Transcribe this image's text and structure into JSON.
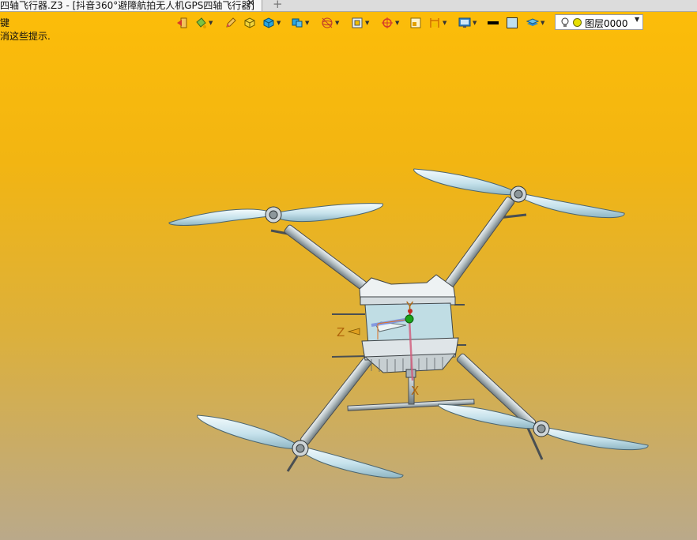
{
  "tab": {
    "title": "四轴飞行器.Z3 - [抖音360°避障航拍无人机GPS四轴飞行器]",
    "close": "✕",
    "add": "+"
  },
  "hints": [
    "键",
    "消这些提示."
  ],
  "toolbar": {
    "tools": [
      {
        "icon": "exit-icon",
        "dropdown": false
      },
      {
        "icon": "paint-bucket-icon",
        "dropdown": true
      },
      {
        "icon": "pencil-icon",
        "dropdown": false
      },
      {
        "icon": "solid-box-icon",
        "dropdown": false
      },
      {
        "icon": "shaded-cube-icon",
        "dropdown": true
      },
      {
        "icon": "stacked-cubes-icon",
        "dropdown": true
      },
      {
        "icon": "wireframe-sphere-icon",
        "dropdown": true
      },
      {
        "icon": "view-frame-icon",
        "dropdown": true
      },
      {
        "icon": "target-snap-icon",
        "dropdown": true
      },
      {
        "icon": "rectangle-select-icon",
        "dropdown": false
      },
      {
        "icon": "dimension-icon",
        "dropdown": true
      },
      {
        "icon": "display-settings-icon",
        "dropdown": true
      },
      {
        "icon": "line-thickness-icon",
        "dropdown": false
      },
      {
        "icon": "color-swatch-icon",
        "dropdown": false
      },
      {
        "icon": "layer-stack-icon",
        "dropdown": true
      }
    ],
    "layer": {
      "label": "图层0000",
      "color": "#e8e000"
    }
  },
  "axes": {
    "y": "Y",
    "z": "Z",
    "x": "X"
  },
  "colors": {
    "bg_top": "#fdbd08",
    "bg_bottom": "#baa98a",
    "propeller": "#cfe6ee",
    "arm": "#b9c3c7",
    "body": "#dfe5e8",
    "body_panel": "#bfe0ee",
    "axis_y": "#d23a3a",
    "axis_z": "#7a8fe0",
    "origin": "#1aa31a",
    "axis_label": "#b0640a"
  }
}
